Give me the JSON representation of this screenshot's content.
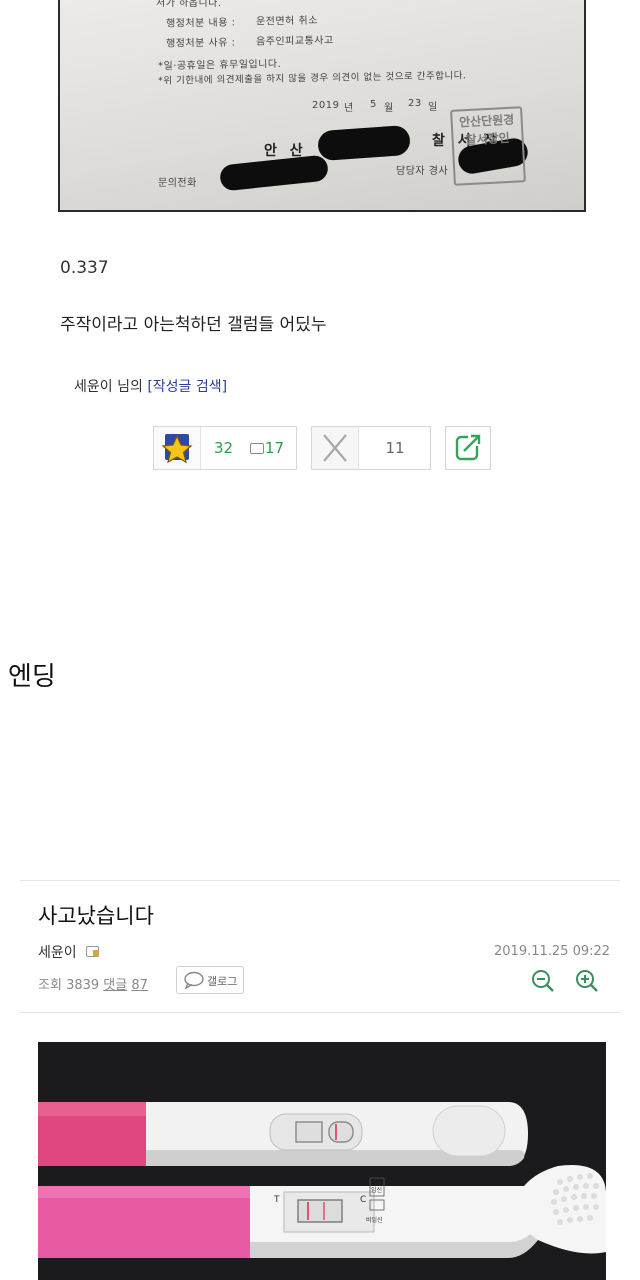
{
  "notice": {
    "header_fragment": "처가 하옵니다.",
    "disposition_label": "행정처분 내용 :",
    "disposition_value": "운전면허 취소",
    "reason_label": "행정처분 사유 :",
    "reason_value": "음주인피교통사고",
    "note1": "*일·공휴일은 휴무일입니다.",
    "note2": "*위 기한내에 의견제출을 하지 않을 경우 의견이 없는 것으로 간주합니다.",
    "date_year": "2019",
    "date_year_unit": "년",
    "date_month": "5",
    "date_month_unit": "월",
    "date_day": "23",
    "date_day_unit": "일",
    "issuer_prefix": "안 산",
    "issuer_suffix": "찰 서 장",
    "contact_label": "문의전화",
    "officer_label": "담당자 경사",
    "seal_text": "안산단원경찰서장인"
  },
  "post": {
    "ratio": "0.337",
    "body": "주작이라고 아는척하던 갤럼들 어딨누",
    "author_prefix": "세윤이 님의",
    "search_link": "[작성글 검색]"
  },
  "votes": {
    "up": "32",
    "scraps": "17",
    "down": "11"
  },
  "caption": "엔딩",
  "post2": {
    "title": "사고났습니다",
    "author": "세윤이",
    "date": "2019.11.25 09:22",
    "views_label": "조회",
    "views": "3839",
    "comments_label": "댓글",
    "comments": "87",
    "blog_label": "갤로그"
  },
  "photo": {
    "label_T": "T",
    "label_C": "C",
    "label_pregnant": "임신",
    "label_not_pregnant": "비임신"
  },
  "colors": {
    "vote_green": "#2e9b4e",
    "link_blue": "#2b3f9a",
    "zoom_green": "#3a8f5c",
    "stick_pink": "#e0467f"
  },
  "icons": {
    "star": "star-icon",
    "downvote": "x-icon",
    "share": "share-icon",
    "zoom_out": "zoom-out-icon",
    "zoom_in": "zoom-in-icon",
    "lock": "lock-icon",
    "speech": "speech-bubble-icon"
  }
}
